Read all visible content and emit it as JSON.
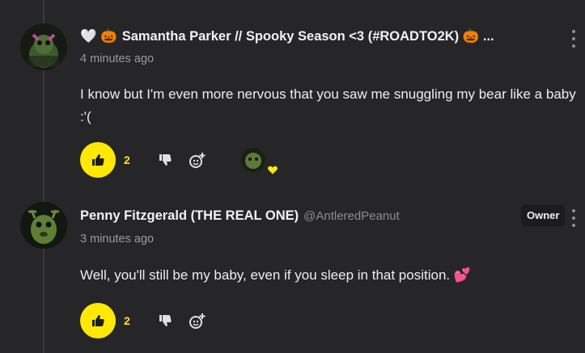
{
  "comments": [
    {
      "author_prefix": "🤍 🎃",
      "author_name": "Samantha Parker // Spooky Season <3 (#ROADTO2K) 🎃 ...",
      "timestamp": "4 minutes ago",
      "body": "I know but I'm even more nervous that you saw me snuggling my bear like a baby :'(",
      "like_count": "2"
    },
    {
      "author_name": "Penny Fitzgerald (THE REAL ONE)",
      "handle": "@AntleredPeanut",
      "badge": "Owner",
      "timestamp": "3 minutes ago",
      "body": "Well, you'll still be my baby, even if you sleep in that position. 💕",
      "like_count": "2"
    }
  ],
  "colors": {
    "accent": "#ffe900",
    "background": "#262629",
    "heart": "#e8243c"
  },
  "icons": [
    "like-icon",
    "dislike-icon",
    "add-reaction-icon",
    "more-options-icon"
  ]
}
